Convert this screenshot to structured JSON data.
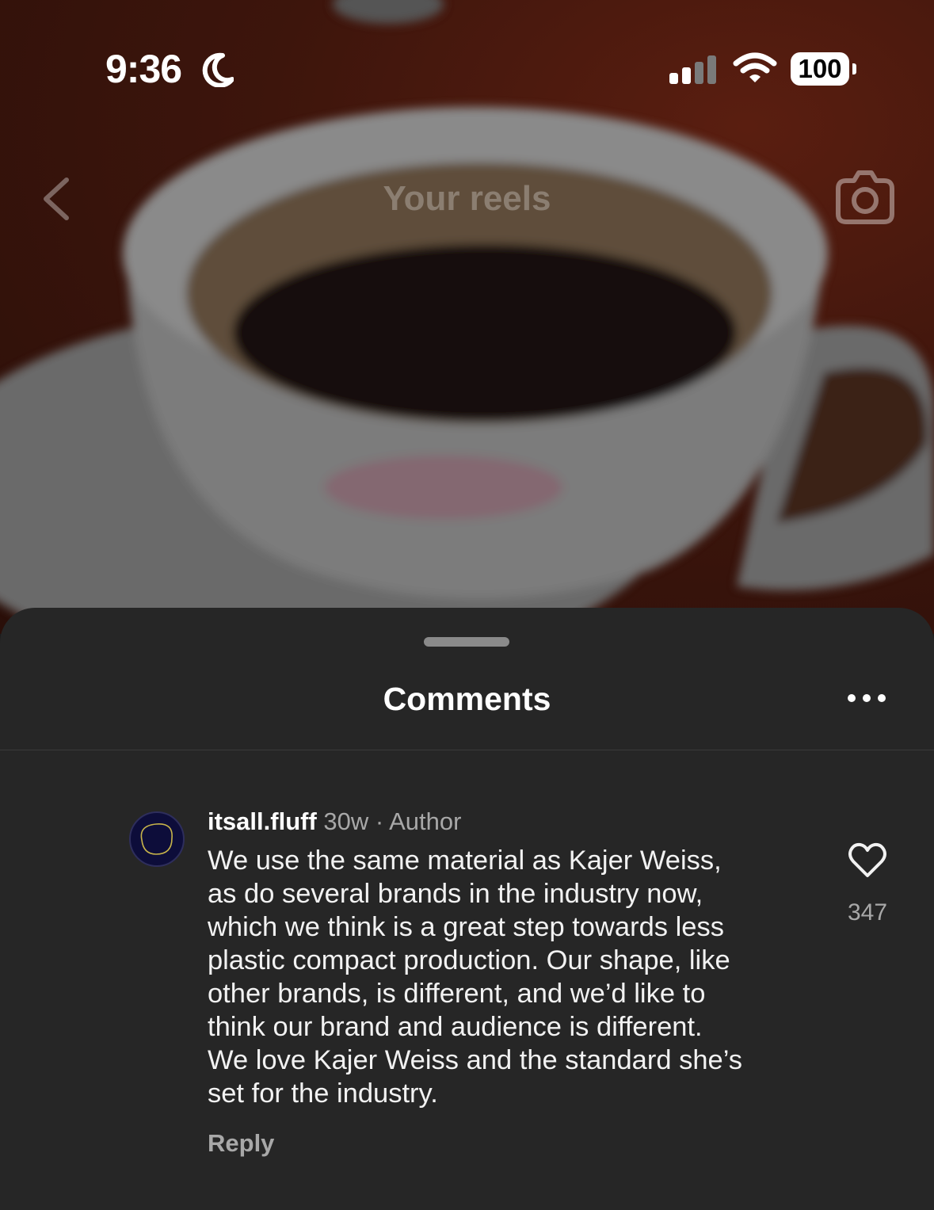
{
  "status_bar": {
    "time": "9:36",
    "battery": "100",
    "icons": [
      "moon-icon",
      "cellular-signal-icon",
      "wifi-icon",
      "battery-icon"
    ]
  },
  "top_bar": {
    "title": "Your reels",
    "icons": [
      "chevron-left-icon",
      "camera-icon"
    ]
  },
  "sheet": {
    "title": "Comments",
    "icons": [
      "more-horizontal-icon"
    ]
  },
  "comment": {
    "username": "itsall.fluff",
    "age": "30w",
    "separator": " · ",
    "badge": "Author",
    "lines": [
      "We use the same material as Kajer Weiss,",
      "as do several brands in the industry now,",
      "which we think is a great step towards less",
      "plastic compact production. Our shape, like",
      "other brands, is different, and we’d like to",
      "think our brand and audience is different.",
      "We love Kajer Weiss and the standard she’s",
      "set for the industry."
    ],
    "reply_label": "Reply",
    "like_count": "347",
    "icons": [
      "avatar",
      "heart-icon"
    ]
  },
  "colors": {
    "sheet_background": "#262626",
    "secondary_text": "#a8a8a8",
    "background_tint": "#3d150c"
  }
}
